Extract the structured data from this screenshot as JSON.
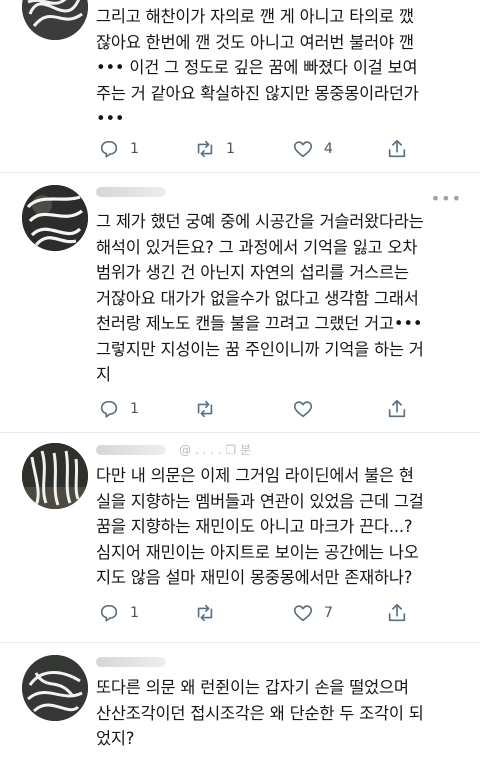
{
  "tweets": [
    {
      "lines": [
        "그리고 해찬이가 자의로 깬 게 아니고 타의로 깼",
        "잖아요 한번에 깬 것도 아니고 여러번 불러야 깬",
        "••• 이건 그 정도로 깊은 꿈에 빠졌다 이걸 보여",
        "주는 거 같아요 확실하진 않지만 몽중몽이라던가",
        "•••"
      ],
      "reply_count": "1",
      "retweet_count": "1",
      "like_count": "4"
    },
    {
      "handle": "",
      "lines": [
        "그 제가 했던 궁예 중에 시공간을 거슬러왔다라는",
        "해석이 있거든요? 그 과정에서 기억을 잃고 오차",
        "범위가 생긴 건 아닌지 자연의 섭리를 거스르는",
        "거잖아요 대가가 없을수가 없다고 생각함 그래서",
        "천러랑 제노도 캔들 불을 끄려고 그랬던 거고•••",
        "그렇지만 지성이는 꿈 주인이니까 기억을 하는 거",
        "지"
      ],
      "reply_count": "1",
      "retweet_count": "",
      "like_count": ""
    },
    {
      "handle": "@ . . . . ❐ 분",
      "lines": [
        "다만 내 의문은 이제 그거임 라이딘에서 불은 현",
        "실을 지향하는 멤버들과 연관이 있었음 근데 그걸",
        "꿈을 지향하는 재민이도 아니고 마크가 끈다...?",
        "심지어 재민이는 아지트로 보이는 공간에는 나오",
        "지도 않음 설마 재민이 몽중몽에서만 존재하나?"
      ],
      "reply_count": "1",
      "retweet_count": "",
      "like_count": "7"
    },
    {
      "handle": "",
      "lines": [
        "또다른 의문 왜 런쥔이는 갑자기 손을 떨었으며",
        "산산조각이던 접시조각은 왜 단순한 두 조각이 되",
        "었지?"
      ]
    }
  ],
  "icons": {
    "more": "more-horizontal-icon",
    "reply": "reply-icon",
    "retweet": "retweet-icon",
    "like": "heart-icon",
    "share": "share-icon"
  },
  "colors": {
    "text": "#14171a",
    "icon": "#5b7083",
    "divider": "#e6ecf0"
  }
}
